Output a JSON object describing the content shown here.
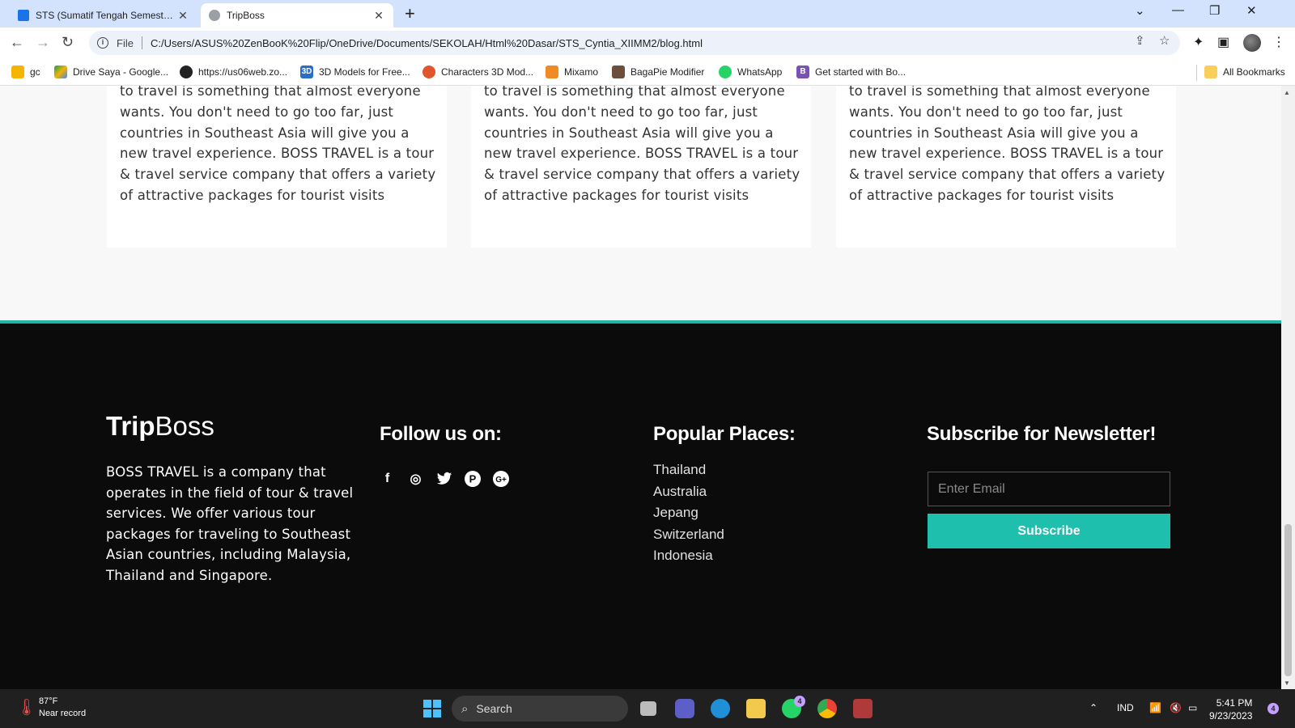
{
  "browser": {
    "tabs": [
      {
        "title": "STS (Sumatif Tengah Semester) C",
        "close": "✕"
      },
      {
        "title": "TripBoss",
        "close": "✕"
      }
    ],
    "new_tab": "+",
    "url_scheme": "File",
    "url": "C:/Users/ASUS%20ZenBooK%20Flip/OneDrive/Documents/SEKOLAH/Html%20Dasar/STS_Cyntia_XIIMM2/blog.html",
    "bookmarks": [
      {
        "label": "gc",
        "icon": "classroom-icon"
      },
      {
        "label": "Drive Saya - Google...",
        "icon": "google-drive-icon"
      },
      {
        "label": "https://us06web.zo...",
        "icon": "zoom-icon"
      },
      {
        "label": "3D Models for Free...",
        "icon": "3d-icon"
      },
      {
        "label": "Characters 3D Mod...",
        "icon": "characters-icon"
      },
      {
        "label": "Mixamo",
        "icon": "mixamo-icon"
      },
      {
        "label": "BagaPie Modifier",
        "icon": "bagapie-icon"
      },
      {
        "label": "WhatsApp",
        "icon": "whatsapp-icon"
      },
      {
        "label": "Get started with Bo...",
        "icon": "bootstrap-icon"
      }
    ],
    "all_bookmarks": "All Bookmarks"
  },
  "blog": {
    "cards": [
      {
        "text": "to travel is something that almost everyone wants. You don't need to go too far, just countries in Southeast Asia will give you a new travel experience. BOSS TRAVEL is a tour & travel service company that offers a variety of attractive packages for tourist visits"
      },
      {
        "text": "to travel is something that almost everyone wants. You don't need to go too far, just countries in Southeast Asia will give you a new travel experience. BOSS TRAVEL is a tour & travel service company that offers a variety of attractive packages for tourist visits"
      },
      {
        "text": "to travel is something that almost everyone wants. You don't need to go too far, just countries in Southeast Asia will give you a new travel experience. BOSS TRAVEL is a tour & travel service company that offers a variety of attractive packages for tourist visits"
      }
    ]
  },
  "footer": {
    "brand_bold": "Trip",
    "brand_light": "Boss",
    "about": "BOSS TRAVEL is a company that operates in the field of tour & travel services. We offer various tour packages for traveling to Southeast Asian countries, including Malaysia, Thailand and Singapore.",
    "follow_heading": "Follow us on:",
    "social": [
      {
        "icon": "facebook-icon",
        "glyph": "f"
      },
      {
        "icon": "instagram-icon",
        "glyph": "◎"
      },
      {
        "icon": "twitter-icon",
        "glyph": "🐦"
      },
      {
        "icon": "pinterest-icon",
        "glyph": "P"
      },
      {
        "icon": "google-plus-icon",
        "glyph": "G+"
      }
    ],
    "places_heading": "Popular Places:",
    "places": [
      "Thailand",
      "Australia",
      "Jepang",
      "Switzerland",
      "Indonesia"
    ],
    "newsletter_heading": "Subscribe for Newsletter!",
    "email_placeholder": "Enter Email",
    "subscribe_label": "Subscribe"
  },
  "taskbar": {
    "temperature": "87°F",
    "weather_note": "Near record",
    "search_label": "Search",
    "language": "IND",
    "time": "5:41 PM",
    "date": "9/23/2023",
    "whatsapp_badge": "4",
    "notification_badge": "4"
  },
  "colors": {
    "accent": "#1fbfae",
    "footer_bg": "#0b0b0b",
    "page_bg": "#f8f8f8"
  }
}
